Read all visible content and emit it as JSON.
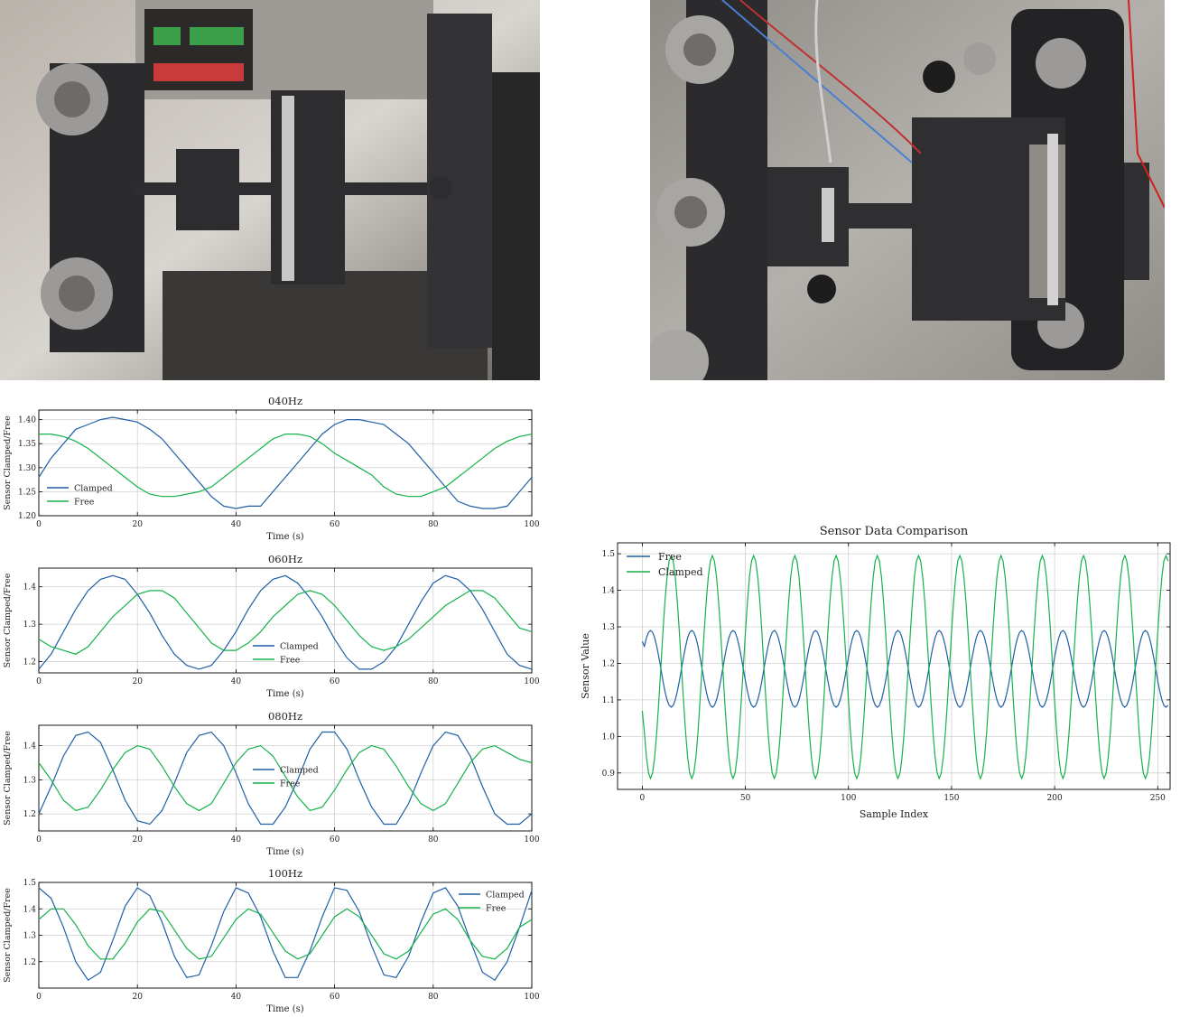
{
  "charts": [
    {
      "type": "line",
      "title": "040Hz",
      "xlabel": "Time (s)",
      "ylabel": "Sensor Clamped/Free",
      "xlim": [
        0,
        100
      ],
      "ylim": [
        1.2,
        1.42
      ],
      "xticks": [
        0,
        20,
        40,
        60,
        80,
        100
      ],
      "yticks": [
        1.2,
        1.25,
        1.3,
        1.35,
        1.4
      ],
      "grid": true,
      "legend": "lower-left",
      "series": [
        {
          "name": "Clamped",
          "color": "#1f5fa6",
          "x": [
            0,
            2.5,
            5,
            7.5,
            10,
            12.5,
            15,
            17.5,
            20,
            22.5,
            25,
            27.5,
            30,
            32.5,
            35,
            37.5,
            40,
            42.5,
            45,
            47.5,
            50,
            52.5,
            55,
            57.5,
            60,
            62.5,
            65,
            67.5,
            70,
            72.5,
            75,
            77.5,
            80,
            82.5,
            85,
            87.5,
            90,
            92.5,
            95,
            97.5,
            100
          ],
          "y": [
            1.28,
            1.32,
            1.35,
            1.38,
            1.39,
            1.4,
            1.405,
            1.4,
            1.395,
            1.38,
            1.36,
            1.33,
            1.3,
            1.27,
            1.24,
            1.22,
            1.215,
            1.22,
            1.22,
            1.25,
            1.28,
            1.31,
            1.34,
            1.37,
            1.39,
            1.4,
            1.4,
            1.395,
            1.39,
            1.37,
            1.35,
            1.32,
            1.29,
            1.26,
            1.23,
            1.22,
            1.215,
            1.215,
            1.22,
            1.25,
            1.28
          ]
        },
        {
          "name": "Free",
          "color": "#14b24a",
          "x": [
            0,
            2.5,
            5,
            7.5,
            10,
            12.5,
            15,
            17.5,
            20,
            22.5,
            25,
            27.5,
            30,
            32.5,
            35,
            37.5,
            40,
            42.5,
            45,
            47.5,
            50,
            52.5,
            55,
            57.5,
            60,
            62.5,
            65,
            67.5,
            70,
            72.5,
            75,
            77.5,
            80,
            82.5,
            85,
            87.5,
            90,
            92.5,
            95,
            97.5,
            100
          ],
          "y": [
            1.37,
            1.37,
            1.365,
            1.355,
            1.34,
            1.32,
            1.3,
            1.28,
            1.26,
            1.245,
            1.24,
            1.24,
            1.245,
            1.25,
            1.26,
            1.28,
            1.3,
            1.32,
            1.34,
            1.36,
            1.37,
            1.37,
            1.365,
            1.35,
            1.33,
            1.315,
            1.3,
            1.285,
            1.26,
            1.245,
            1.24,
            1.24,
            1.25,
            1.26,
            1.28,
            1.3,
            1.32,
            1.34,
            1.355,
            1.365,
            1.37
          ]
        }
      ]
    },
    {
      "type": "line",
      "title": "060Hz",
      "xlabel": "Time (s)",
      "ylabel": "Sensor Clamped/Free",
      "xlim": [
        0,
        100
      ],
      "ylim": [
        1.17,
        1.45
      ],
      "xticks": [
        0,
        20,
        40,
        60,
        80,
        100
      ],
      "yticks": [
        1.2,
        1.3,
        1.4
      ],
      "grid": true,
      "legend": "lower-center",
      "series": [
        {
          "name": "Clamped",
          "color": "#1f5fa6",
          "x": [
            0,
            2.5,
            5,
            7.5,
            10,
            12.5,
            15,
            17.5,
            20,
            22.5,
            25,
            27.5,
            30,
            32.5,
            35,
            37.5,
            40,
            42.5,
            45,
            47.5,
            50,
            52.5,
            55,
            57.5,
            60,
            62.5,
            65,
            67.5,
            70,
            72.5,
            75,
            77.5,
            80,
            82.5,
            85,
            87.5,
            90,
            92.5,
            95,
            97.5,
            100
          ],
          "y": [
            1.18,
            1.22,
            1.28,
            1.34,
            1.39,
            1.42,
            1.43,
            1.42,
            1.38,
            1.33,
            1.27,
            1.22,
            1.19,
            1.18,
            1.19,
            1.23,
            1.28,
            1.34,
            1.39,
            1.42,
            1.43,
            1.41,
            1.37,
            1.32,
            1.26,
            1.21,
            1.18,
            1.18,
            1.2,
            1.24,
            1.3,
            1.36,
            1.41,
            1.43,
            1.42,
            1.39,
            1.34,
            1.28,
            1.22,
            1.19,
            1.18
          ]
        },
        {
          "name": "Free",
          "color": "#14b24a",
          "x": [
            0,
            2.5,
            5,
            7.5,
            10,
            12.5,
            15,
            17.5,
            20,
            22.5,
            25,
            27.5,
            30,
            32.5,
            35,
            37.5,
            40,
            42.5,
            45,
            47.5,
            50,
            52.5,
            55,
            57.5,
            60,
            62.5,
            65,
            67.5,
            70,
            72.5,
            75,
            77.5,
            80,
            82.5,
            85,
            87.5,
            90,
            92.5,
            95,
            97.5,
            100
          ],
          "y": [
            1.26,
            1.24,
            1.23,
            1.22,
            1.24,
            1.28,
            1.32,
            1.35,
            1.38,
            1.39,
            1.39,
            1.37,
            1.33,
            1.29,
            1.25,
            1.23,
            1.23,
            1.25,
            1.28,
            1.32,
            1.35,
            1.38,
            1.39,
            1.38,
            1.35,
            1.31,
            1.27,
            1.24,
            1.23,
            1.24,
            1.26,
            1.29,
            1.32,
            1.35,
            1.37,
            1.39,
            1.39,
            1.37,
            1.33,
            1.29,
            1.28
          ]
        }
      ]
    },
    {
      "type": "line",
      "title": "080Hz",
      "xlabel": "Time (s)",
      "ylabel": "Sensor Clamped/Free",
      "xlim": [
        0,
        100
      ],
      "ylim": [
        1.15,
        1.46
      ],
      "xticks": [
        0,
        20,
        40,
        60,
        80,
        100
      ],
      "yticks": [
        1.2,
        1.3,
        1.4
      ],
      "grid": true,
      "legend": "center",
      "series": [
        {
          "name": "Clamped",
          "color": "#1f5fa6",
          "x": [
            0,
            2.5,
            5,
            7.5,
            10,
            12.5,
            15,
            17.5,
            20,
            22.5,
            25,
            27.5,
            30,
            32.5,
            35,
            37.5,
            40,
            42.5,
            45,
            47.5,
            50,
            52.5,
            55,
            57.5,
            60,
            62.5,
            65,
            67.5,
            70,
            72.5,
            75,
            77.5,
            80,
            82.5,
            85,
            87.5,
            90,
            92.5,
            95,
            97.5,
            100
          ],
          "y": [
            1.2,
            1.28,
            1.37,
            1.43,
            1.44,
            1.41,
            1.33,
            1.24,
            1.18,
            1.17,
            1.21,
            1.29,
            1.38,
            1.43,
            1.44,
            1.4,
            1.32,
            1.23,
            1.17,
            1.17,
            1.22,
            1.3,
            1.39,
            1.44,
            1.44,
            1.39,
            1.3,
            1.22,
            1.17,
            1.17,
            1.23,
            1.32,
            1.4,
            1.44,
            1.43,
            1.37,
            1.28,
            1.2,
            1.17,
            1.17,
            1.2
          ]
        },
        {
          "name": "Free",
          "color": "#14b24a",
          "x": [
            0,
            2.5,
            5,
            7.5,
            10,
            12.5,
            15,
            17.5,
            20,
            22.5,
            25,
            27.5,
            30,
            32.5,
            35,
            37.5,
            40,
            42.5,
            45,
            47.5,
            50,
            52.5,
            55,
            57.5,
            60,
            62.5,
            65,
            67.5,
            70,
            72.5,
            75,
            77.5,
            80,
            82.5,
            85,
            87.5,
            90,
            92.5,
            95,
            97.5,
            100
          ],
          "y": [
            1.35,
            1.3,
            1.24,
            1.21,
            1.22,
            1.27,
            1.33,
            1.38,
            1.4,
            1.39,
            1.34,
            1.28,
            1.23,
            1.21,
            1.23,
            1.29,
            1.35,
            1.39,
            1.4,
            1.37,
            1.31,
            1.25,
            1.21,
            1.22,
            1.27,
            1.33,
            1.38,
            1.4,
            1.39,
            1.34,
            1.28,
            1.23,
            1.21,
            1.23,
            1.29,
            1.35,
            1.39,
            1.4,
            1.38,
            1.36,
            1.35
          ]
        }
      ]
    },
    {
      "type": "line",
      "title": "100Hz",
      "xlabel": "Time (s)",
      "ylabel": "Sensor Clamped/Free",
      "xlim": [
        0,
        100
      ],
      "ylim": [
        1.1,
        1.5
      ],
      "xticks": [
        0,
        20,
        40,
        60,
        80,
        100
      ],
      "yticks": [
        1.2,
        1.3,
        1.4,
        1.5
      ],
      "grid": true,
      "legend": "upper-right",
      "series": [
        {
          "name": "Clamped",
          "color": "#1f5fa6",
          "x": [
            0,
            2.5,
            5,
            7.5,
            10,
            12.5,
            15,
            17.5,
            20,
            22.5,
            25,
            27.5,
            30,
            32.5,
            35,
            37.5,
            40,
            42.5,
            45,
            47.5,
            50,
            52.5,
            55,
            57.5,
            60,
            62.5,
            65,
            67.5,
            70,
            72.5,
            75,
            77.5,
            80,
            82.5,
            85,
            87.5,
            90,
            92.5,
            95,
            97.5,
            100
          ],
          "y": [
            1.48,
            1.44,
            1.33,
            1.2,
            1.13,
            1.16,
            1.28,
            1.41,
            1.48,
            1.45,
            1.35,
            1.22,
            1.14,
            1.15,
            1.26,
            1.39,
            1.48,
            1.46,
            1.37,
            1.24,
            1.14,
            1.14,
            1.24,
            1.37,
            1.48,
            1.47,
            1.39,
            1.26,
            1.15,
            1.14,
            1.22,
            1.35,
            1.46,
            1.48,
            1.41,
            1.28,
            1.16,
            1.13,
            1.2,
            1.33,
            1.47
          ]
        },
        {
          "name": "Free",
          "color": "#14b24a",
          "x": [
            0,
            2.5,
            5,
            7.5,
            10,
            12.5,
            15,
            17.5,
            20,
            22.5,
            25,
            27.5,
            30,
            32.5,
            35,
            37.5,
            40,
            42.5,
            45,
            47.5,
            50,
            52.5,
            55,
            57.5,
            60,
            62.5,
            65,
            67.5,
            70,
            72.5,
            75,
            77.5,
            80,
            82.5,
            85,
            87.5,
            90,
            92.5,
            95,
            97.5,
            100
          ],
          "y": [
            1.36,
            1.4,
            1.4,
            1.34,
            1.26,
            1.21,
            1.21,
            1.27,
            1.35,
            1.4,
            1.39,
            1.32,
            1.25,
            1.21,
            1.22,
            1.29,
            1.36,
            1.4,
            1.38,
            1.31,
            1.24,
            1.21,
            1.23,
            1.3,
            1.37,
            1.4,
            1.37,
            1.3,
            1.23,
            1.21,
            1.24,
            1.31,
            1.38,
            1.4,
            1.36,
            1.28,
            1.22,
            1.21,
            1.25,
            1.33,
            1.36
          ]
        }
      ]
    }
  ],
  "chart_data": {
    "type": "line",
    "title": "Sensor Data Comparison",
    "xlabel": "Sample Index",
    "ylabel": "Sensor Value",
    "xlim": [
      -12,
      256
    ],
    "ylim": [
      0.855,
      1.53
    ],
    "xticks": [
      0,
      50,
      100,
      150,
      200,
      250
    ],
    "yticks": [
      0.9,
      1.0,
      1.1,
      1.2,
      1.3,
      1.4,
      1.5
    ],
    "grid": true,
    "legend": "upper-left",
    "period_samples": 20,
    "n_samples": 256,
    "series": [
      {
        "name": "Free",
        "color": "#1f5fa6",
        "center": 1.185,
        "amplitude": 0.105,
        "phase_deg": 180,
        "start": 1.26
      },
      {
        "name": "Clamped",
        "color": "#14b24a",
        "center": 1.19,
        "amplitude": 0.305,
        "phase_deg": 0,
        "start": 1.07
      }
    ]
  },
  "photos": {
    "left_alt": "",
    "right_alt": ""
  }
}
